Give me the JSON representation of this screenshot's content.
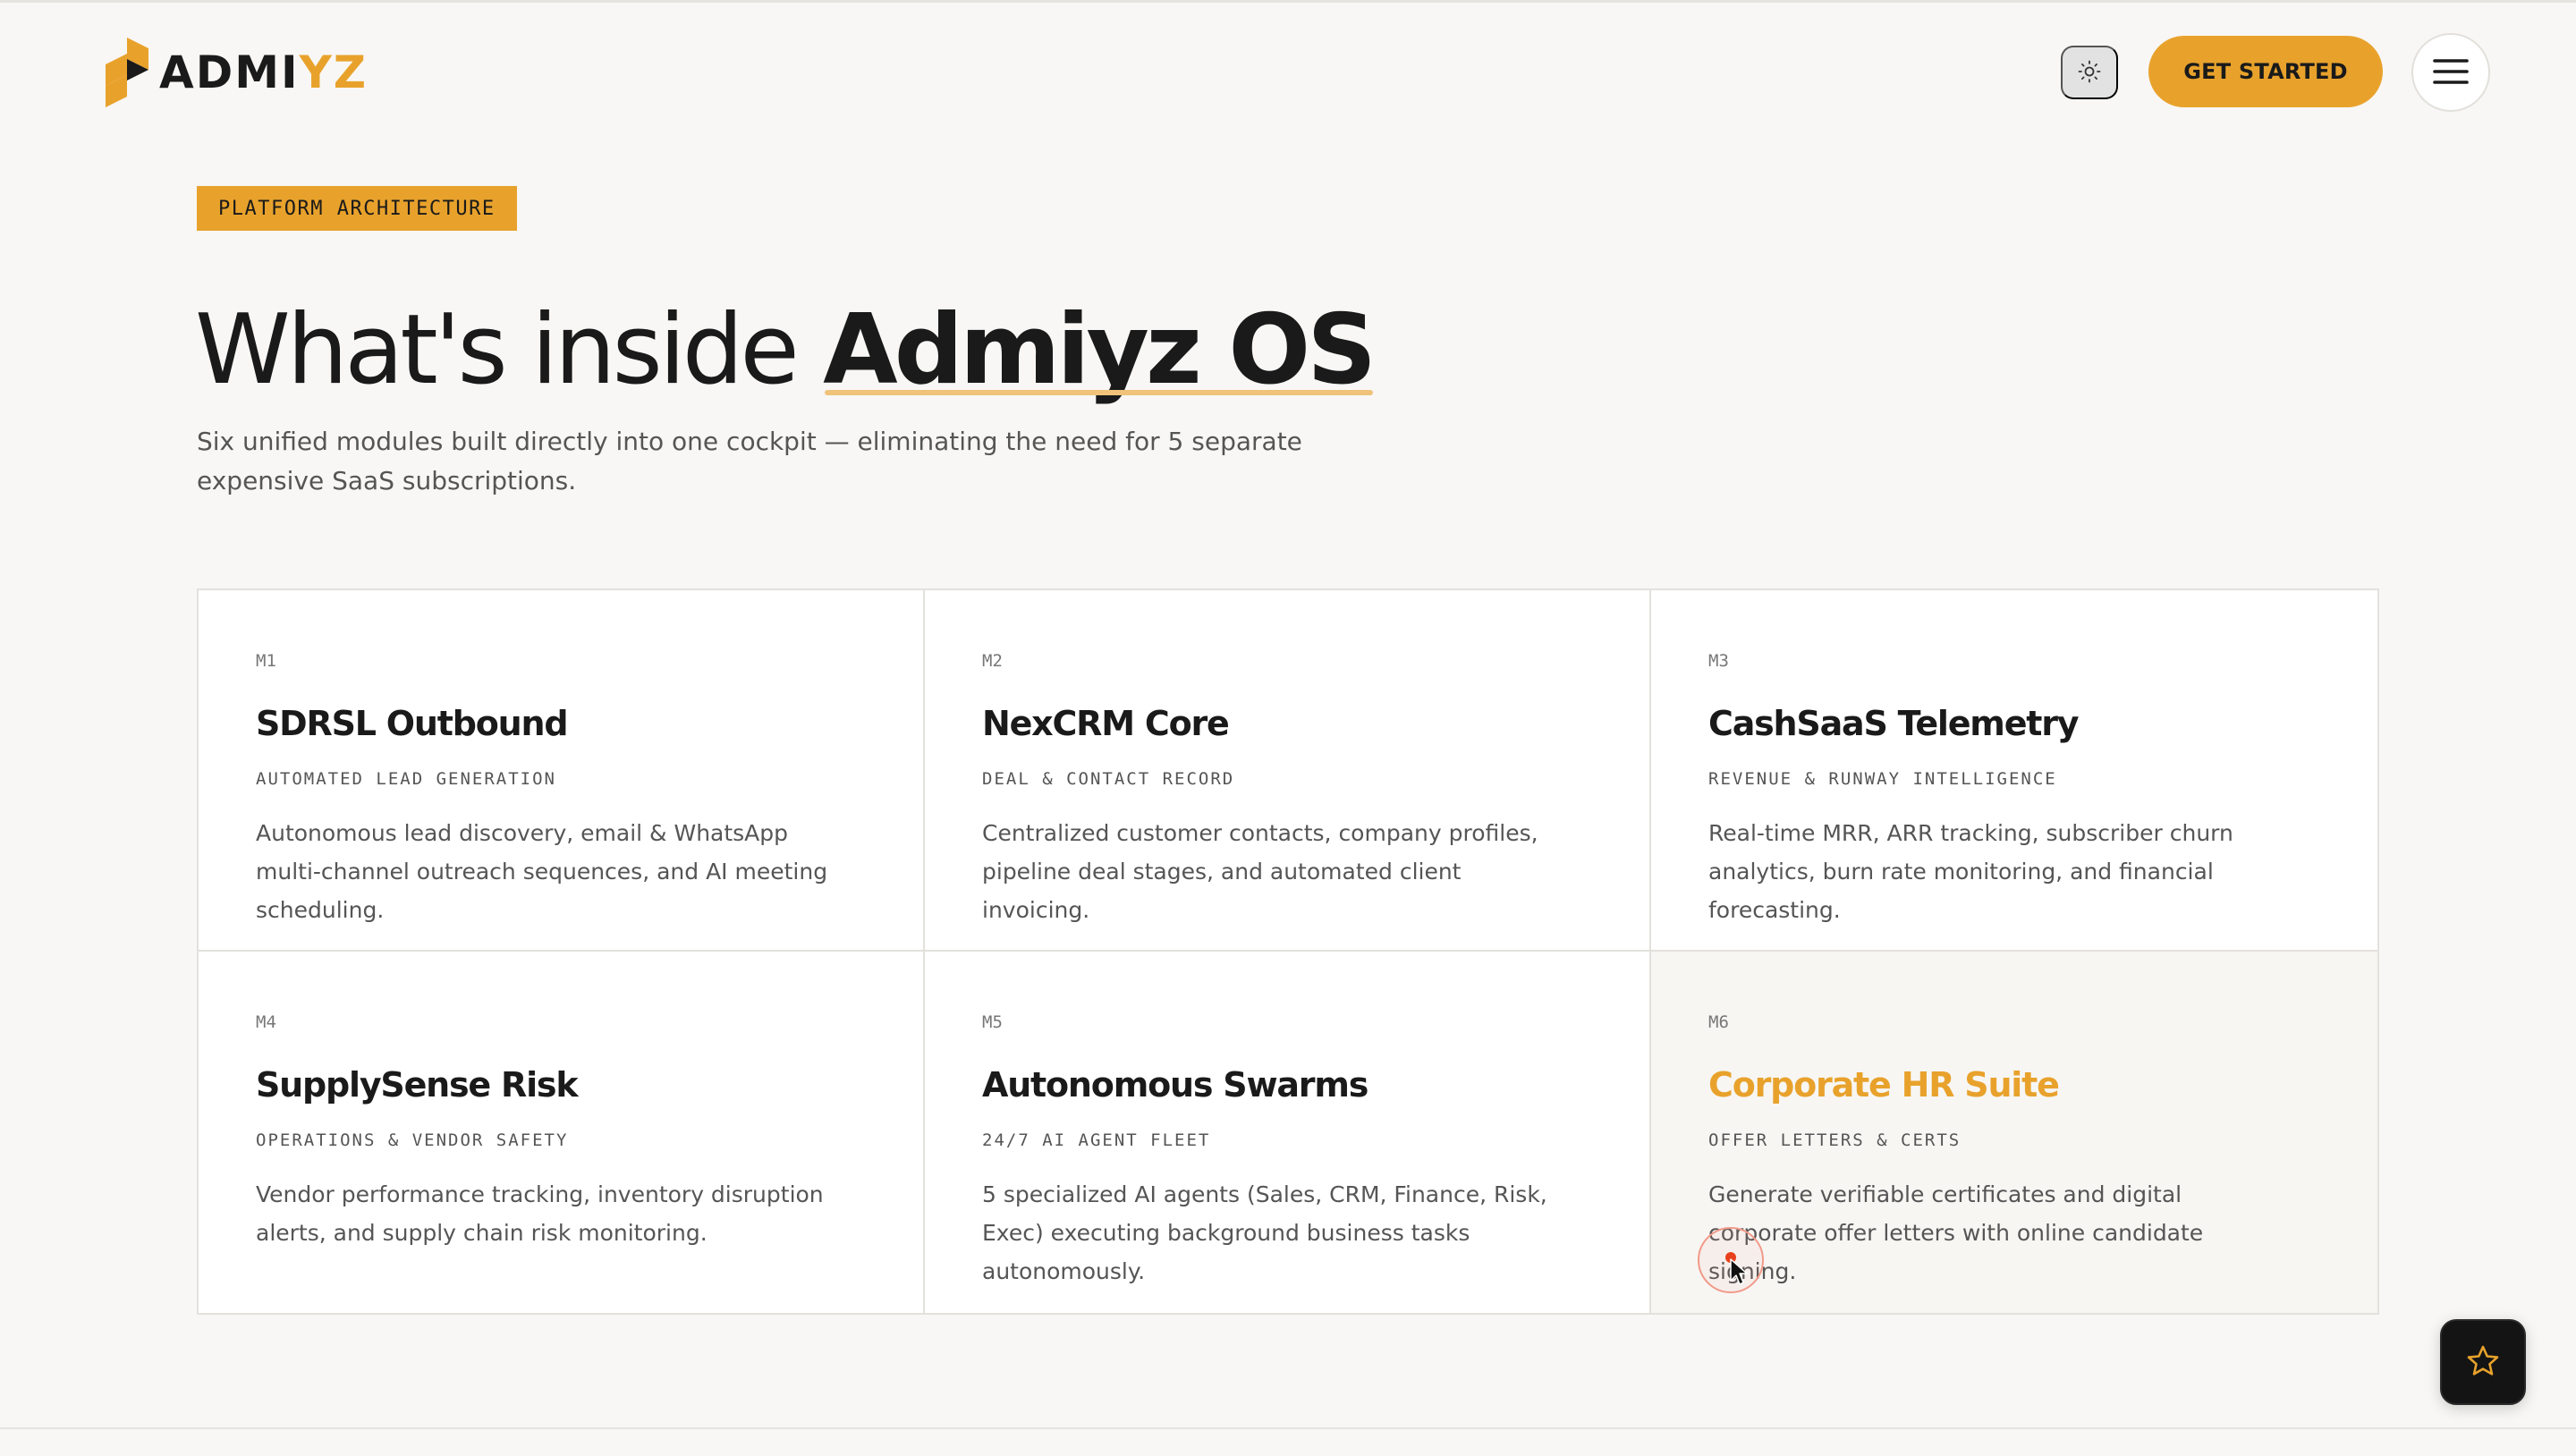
{
  "brand": {
    "logo_dark": "ADMI",
    "logo_gold": "YZ",
    "accent_color": "#e8a22c",
    "icon": "admiyz-logo-icon"
  },
  "header": {
    "theme_toggle_icon": "sun-icon",
    "cta_label": "GET STARTED",
    "menu_icon": "hamburger-menu-icon"
  },
  "hero": {
    "tag": "PLATFORM ARCHITECTURE",
    "title_light": "What's inside ",
    "title_strong": "Admiyz OS",
    "subtitle": "Six unified modules built directly into one cockpit — eliminating the need for 5 separate expensive SaaS subscriptions."
  },
  "modules": [
    {
      "num": "M1",
      "title": "SDRSL Outbound",
      "subtitle": "AUTOMATED LEAD GENERATION",
      "desc": "Autonomous lead discovery, email & WhatsApp multi-channel outreach sequences, and AI meeting scheduling."
    },
    {
      "num": "M2",
      "title": "NexCRM Core",
      "subtitle": "DEAL & CONTACT RECORD",
      "desc": "Centralized customer contacts, company profiles, pipeline deal stages, and automated client invoicing."
    },
    {
      "num": "M3",
      "title": "CashSaaS Telemetry",
      "subtitle": "REVENUE & RUNWAY INTELLIGENCE",
      "desc": "Real-time MRR, ARR tracking, subscriber churn analytics, burn rate monitoring, and financial forecasting."
    },
    {
      "num": "M4",
      "title": "SupplySense Risk",
      "subtitle": "OPERATIONS & VENDOR SAFETY",
      "desc": "Vendor performance tracking, inventory disruption alerts, and supply chain risk monitoring."
    },
    {
      "num": "M5",
      "title": "Autonomous Swarms",
      "subtitle": "24/7 AI AGENT FLEET",
      "desc": "5 specialized AI agents (Sales, CRM, Finance, Risk, Exec) executing background business tasks autonomously."
    },
    {
      "num": "M6",
      "title": "Corporate HR Suite",
      "subtitle": "OFFER LETTERS & CERTS",
      "desc": "Generate verifiable certificates and digital corporate offer letters with online candidate signing."
    }
  ],
  "floating": {
    "icon": "star-icon"
  }
}
